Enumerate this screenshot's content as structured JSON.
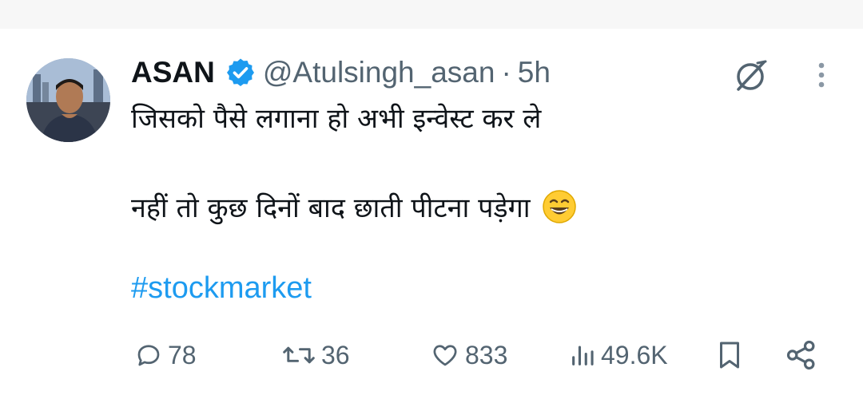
{
  "tweet": {
    "display_name": "ASAN",
    "handle": "@Atulsingh_asan",
    "separator": "·",
    "time": "5h",
    "text_line1": "जिसको पैसे लगाना हो अभी इन्वेस्ट कर ले",
    "text_line2": "नहीं तो कुछ दिनों बाद छाती पीटना पड़ेगा",
    "emoji": "grinning-squinting-face",
    "hashtag": "#stockmarket"
  },
  "actions": {
    "replies": "78",
    "reposts": "36",
    "likes": "833",
    "views": "49.6K"
  },
  "icons": [
    "grok-icon",
    "more-icon",
    "verified-badge-icon",
    "reply-icon",
    "repost-icon",
    "like-icon",
    "views-icon",
    "bookmark-icon",
    "share-icon"
  ],
  "colors": {
    "accent": "#1d9bf0",
    "muted": "#536471",
    "text": "#0f1419"
  }
}
